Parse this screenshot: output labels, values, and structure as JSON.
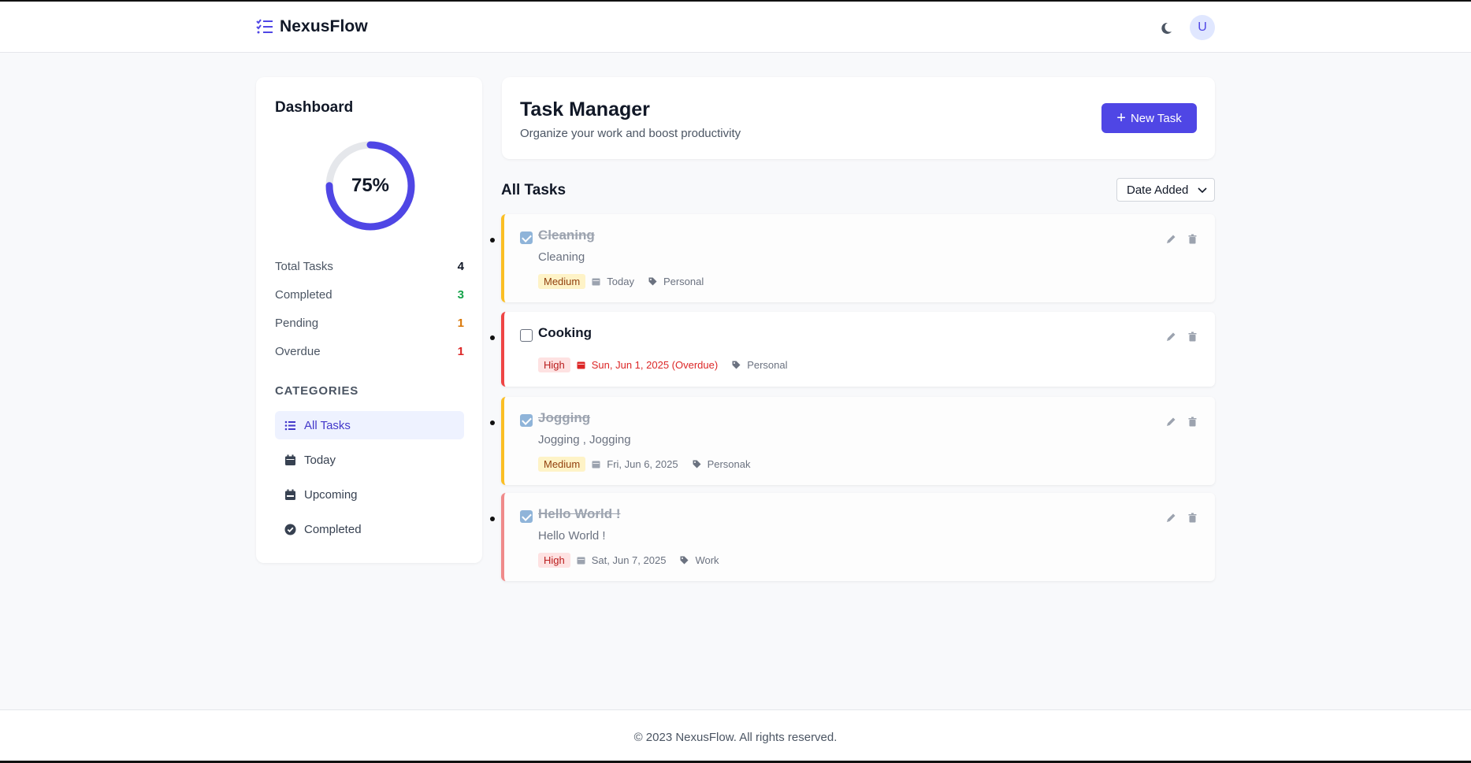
{
  "app": {
    "name": "NexusFlow",
    "avatar_initial": "U"
  },
  "colors": {
    "accent": "#4f46e5",
    "medium": "#fbbf24",
    "high": "#ef4444",
    "completed_value": "#16a34a",
    "pending_value": "#d97706",
    "overdue_value": "#dc2626"
  },
  "sidebar": {
    "title": "Dashboard",
    "progress": {
      "percent": 75,
      "label": "75%"
    },
    "stats": [
      {
        "label": "Total Tasks",
        "value": "4"
      },
      {
        "label": "Completed",
        "value": "3"
      },
      {
        "label": "Pending",
        "value": "1"
      },
      {
        "label": "Overdue",
        "value": "1"
      }
    ],
    "categories_title": "CATEGORIES",
    "categories": [
      {
        "label": "All Tasks",
        "icon": "list-icon",
        "active": true
      },
      {
        "label": "Today",
        "icon": "calendar-day-icon",
        "active": false
      },
      {
        "label": "Upcoming",
        "icon": "calendar-week-icon",
        "active": false
      },
      {
        "label": "Completed",
        "icon": "check-circle-icon",
        "active": false
      }
    ]
  },
  "main": {
    "title": "Task Manager",
    "subtitle": "Organize your work and boost productivity",
    "new_button": "New Task",
    "list_title": "All Tasks",
    "sort_selected": "Date Added"
  },
  "tasks": [
    {
      "title": "Cleaning",
      "description": "Cleaning",
      "completed": true,
      "priority": "Medium",
      "due": "Today",
      "overdue": false,
      "category": "Personal"
    },
    {
      "title": "Cooking",
      "description": "",
      "completed": false,
      "priority": "High",
      "due": "Sun, Jun 1, 2025 (Overdue)",
      "overdue": true,
      "category": "Personal"
    },
    {
      "title": "Jogging",
      "description": "Jogging , Jogging",
      "completed": true,
      "priority": "Medium",
      "due": "Fri, Jun 6, 2025",
      "overdue": false,
      "category": "Personak"
    },
    {
      "title": "Hello World !",
      "description": "Hello World !",
      "completed": true,
      "priority": "High",
      "due": "Sat, Jun 7, 2025",
      "overdue": false,
      "category": "Work"
    }
  ],
  "footer": {
    "text": "© 2023 NexusFlow. All rights reserved."
  }
}
